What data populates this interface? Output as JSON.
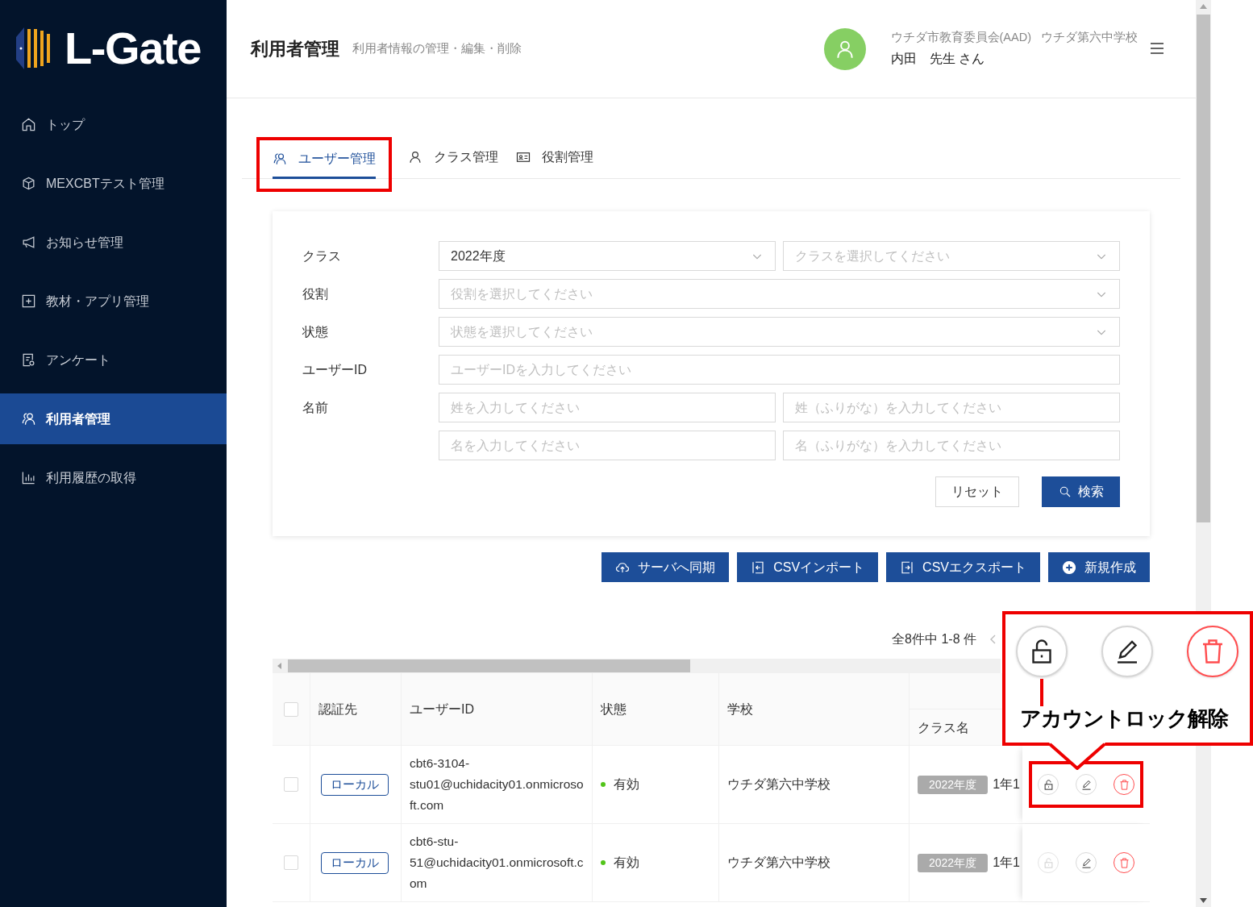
{
  "sidebar": {
    "logo": "L-Gate",
    "items": [
      {
        "label": "トップ",
        "selected": false
      },
      {
        "label": "MEXCBTテスト管理",
        "selected": false
      },
      {
        "label": "お知らせ管理",
        "selected": false
      },
      {
        "label": "教材・アプリ管理",
        "selected": false
      },
      {
        "label": "アンケート",
        "selected": false
      },
      {
        "label": "利用者管理",
        "selected": true
      },
      {
        "label": "利用履歴の取得",
        "selected": false
      }
    ]
  },
  "header": {
    "title": "利用者管理",
    "subtitle": "利用者情報の管理・編集・削除",
    "org": "ウチダ市教育委員会(AAD)",
    "school": "ウチダ第六中学校",
    "user": "内田　先生 さん"
  },
  "tabs": [
    {
      "label": "ユーザー管理",
      "selected": true,
      "highlighted": true
    },
    {
      "label": "クラス管理",
      "selected": false,
      "highlighted": false
    },
    {
      "label": "役割管理",
      "selected": false,
      "highlighted": false
    }
  ],
  "filters": [
    {
      "label": "クラス",
      "fields": [
        {
          "kind": "select",
          "value": "2022年度"
        },
        {
          "kind": "select",
          "placeholder": "クラスを選択してください"
        }
      ]
    },
    {
      "label": "役割",
      "fields": [
        {
          "kind": "select",
          "placeholder": "役割を選択してください"
        }
      ]
    },
    {
      "label": "状態",
      "fields": [
        {
          "kind": "select",
          "placeholder": "状態を選択してください"
        }
      ]
    },
    {
      "label": "ユーザーID",
      "fields": [
        {
          "kind": "input",
          "placeholder": "ユーザーIDを入力してください"
        }
      ]
    },
    {
      "label": "名前",
      "fields": [
        {
          "kind": "input",
          "placeholder": "姓を入力してください"
        },
        {
          "kind": "input",
          "placeholder": "姓（ふりがな）を入力してください"
        }
      ]
    },
    {
      "fields": [
        {
          "kind": "input",
          "placeholder": "名を入力してください"
        },
        {
          "kind": "input",
          "placeholder": "名（ふりがな）を入力してください"
        }
      ]
    }
  ],
  "filter_buttons": [
    {
      "label": "リセット",
      "kind": "secondary"
    },
    {
      "label": "検索",
      "kind": "primary"
    }
  ],
  "actions": [
    {
      "label": "サーバへ同期"
    },
    {
      "label": "CSVインポート"
    },
    {
      "label": "CSVエクスポート"
    },
    {
      "label": "新規作成"
    }
  ],
  "pagination": {
    "summary": "全8件中 1-8 件"
  },
  "table": {
    "all_checked": false,
    "columns": [
      "認証先",
      "ユーザーID",
      "状態",
      "学校"
    ],
    "class_column": "クラス名",
    "rows": [
      {
        "checked": false,
        "auth": "ローカル",
        "user_id": "cbt6-3104-stu01@uchidacity01.onmicrosoft.com",
        "status": "有効",
        "school": "ウチダ第六中学校",
        "year": "2022年度",
        "class": "1年1",
        "lock_disabled": false,
        "highlighted": true
      },
      {
        "checked": false,
        "auth": "ローカル",
        "user_id": "cbt6-stu-51@uchidacity01.onmicrosoft.com",
        "status": "有効",
        "school": "ウチダ第六中学校",
        "year": "2022年度",
        "class": "1年1",
        "lock_disabled": true,
        "highlighted": false
      }
    ]
  },
  "callout": {
    "label": "アカウントロック解除"
  }
}
